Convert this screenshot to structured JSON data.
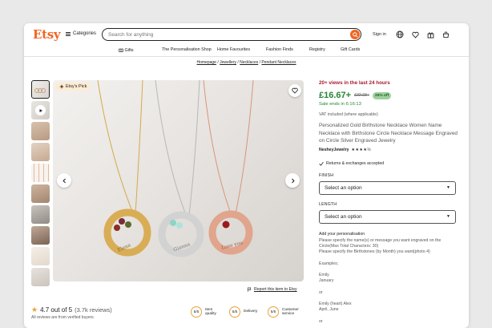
{
  "header": {
    "logo": "Etsy",
    "categories_label": "Categories",
    "search_placeholder": "Search for anything",
    "signin_label": "Sign in"
  },
  "subnav": {
    "items": [
      "Gifts",
      "The Personalisation Shop",
      "Home Favourites",
      "Fashion Finds",
      "Registry",
      "Gift Cards"
    ]
  },
  "breadcrumb": {
    "items": [
      "Homepage",
      "Jewellery",
      "Necklaces",
      "Pendant Necklaces"
    ],
    "separator": "/"
  },
  "gallery": {
    "badge": "Etsy's Pick",
    "pendant_texts": [
      "Elena",
      "Gianna",
      "Love you"
    ]
  },
  "report_label": "Report this item to Etsy",
  "reviews": {
    "rating_text": "4.7 out of 5",
    "count": "(3.7k reviews)",
    "verified": "All reviews are from verified buyers",
    "scores": [
      {
        "score": "5/5",
        "label": "Item quality"
      },
      {
        "score": "5/5",
        "label": "Delivery"
      },
      {
        "score": "5/5",
        "label": "Customer service"
      }
    ]
  },
  "listing": {
    "views": "20+ views in the last 24 hours",
    "price": "£16.67+",
    "old_price": "£22.23+",
    "discount": "25% off",
    "sale_ends": "Sale ends in 6:16:13",
    "vat": "VAT included (where applicable)",
    "title": "Personalized Gold Birthstone Necklace Women Name Necklace with Birthstone Circle Necklace Message Engraved on Circle Silver Engraved Jewelry",
    "shop_name": "NesheyJewelry",
    "stars": "★★★★½",
    "returns": "Returns & exchanges accepted",
    "finish_label": "FINISH",
    "finish_value": "Select an option",
    "length_label": "LENGTH",
    "length_value": "Select an option",
    "personalisation_label": "Add your personalisation",
    "personalisation_text": "Please specify the name(s) or message you want engraved on the Circle(Max Total Characters: 30)\nPlease specify the Birthstones (by Month) you want(photo 4)\n\nExamples;\n\nEmily\nJanuary\n\nor\n\nEmily (heart) Alex\nApril, June\n\nor"
  },
  "colors": {
    "brand": "#f1641e",
    "sale_green": "#258635",
    "views_red": "#a61a2e"
  }
}
